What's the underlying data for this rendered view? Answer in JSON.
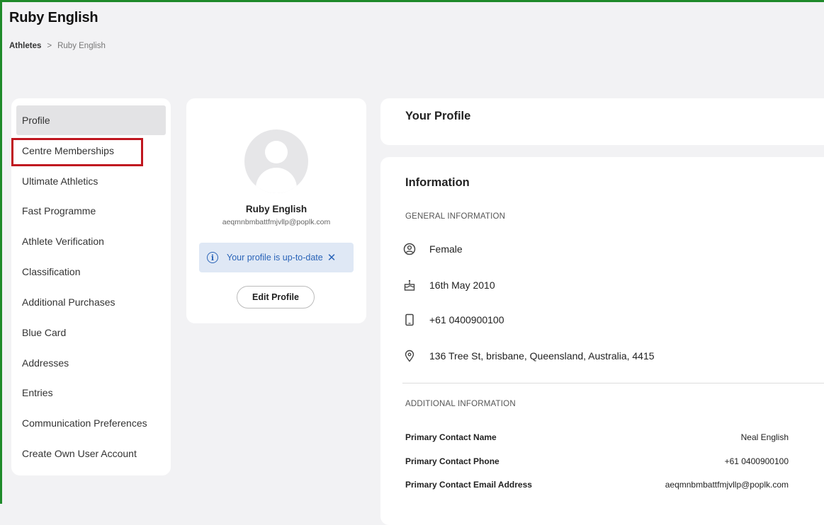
{
  "header": {
    "title": "Ruby English",
    "breadcrumb": {
      "link": "Athletes",
      "separator": ">",
      "current": "Ruby English"
    }
  },
  "sidebar": {
    "items": [
      {
        "label": "Profile",
        "active": true
      },
      {
        "label": "Centre Memberships"
      },
      {
        "label": "Ultimate Athletics"
      },
      {
        "label": "Fast Programme"
      },
      {
        "label": "Athlete Verification"
      },
      {
        "label": "Classification"
      },
      {
        "label": "Additional Purchases"
      },
      {
        "label": "Blue Card"
      },
      {
        "label": "Addresses"
      },
      {
        "label": "Entries"
      },
      {
        "label": "Communication Preferences"
      },
      {
        "label": "Create Own User Account"
      }
    ]
  },
  "profile_card": {
    "name": "Ruby English",
    "email": "aeqmnbmbattfmjvllp@poplk.com",
    "notice": "Your profile is up-to-date",
    "edit_label": "Edit Profile"
  },
  "your_profile": {
    "title": "Your Profile"
  },
  "information": {
    "title": "Information",
    "general_label": "GENERAL INFORMATION",
    "general": [
      {
        "icon": "person-circle-icon",
        "value": "Female"
      },
      {
        "icon": "birthday-cake-icon",
        "value": "16th May 2010"
      },
      {
        "icon": "phone-icon",
        "value": "+61 0400900100"
      },
      {
        "icon": "location-pin-icon",
        "value": "136 Tree St, brisbane, Queensland, Australia, 4415"
      }
    ],
    "additional_label": "ADDITIONAL INFORMATION",
    "additional": [
      {
        "label": "Primary Contact Name",
        "value": "Neal English"
      },
      {
        "label": "Primary Contact Phone",
        "value": "+61 0400900100"
      },
      {
        "label": "Primary Contact Email Address",
        "value": "aeqmnbmbattfmjvllp@poplk.com"
      }
    ]
  },
  "colors": {
    "accent": "#2a64b8",
    "notice_bg": "#dfe8f5",
    "highlight": "#c0161f",
    "frame": "#1f8a2a"
  }
}
